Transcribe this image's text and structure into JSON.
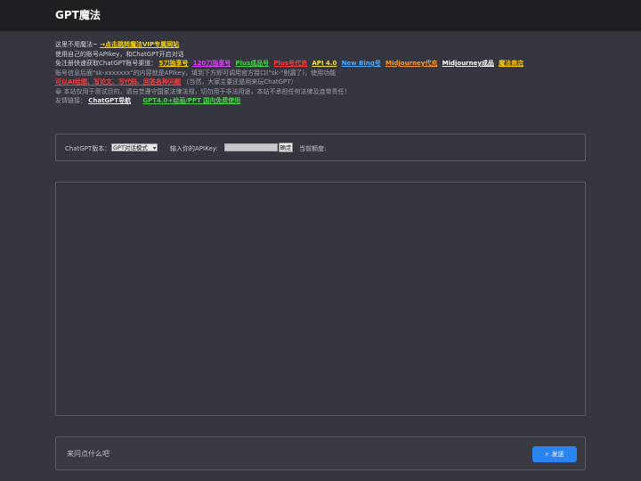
{
  "header": {
    "title": "GPT魔法"
  },
  "notice": {
    "line1": {
      "prefix": "这里不用魔法~",
      "link": "→点击跳转魔法VIP专属网站"
    },
    "line2": "使用自己的账号APIkey，和ChatGPT开启对话",
    "line3": {
      "prefix": "免注册快速获取ChatGPT账号渠道：",
      "links": [
        "5刀独享号",
        "120刀独享号",
        "Plus成品号",
        "Plus号代充",
        "API 4.0",
        "New Bing号",
        "Midjourney代充",
        "Midjourney成品",
        "魔法商店"
      ]
    },
    "line4": "账号信息后面\"sk-xxxxxxx\"的内容就是APIkey，填到下方即可调用官方接口(\"sk-\"别漏了)，使用功能",
    "line5": {
      "red": "可以AI绘图、写论文、写代码、回答各种问题",
      "rest": "（当然，大家主要还是用来玩ChatGPT）"
    },
    "line6": "😀 本站仅用于测试目的，请自觉遵守国家法律法规，切勿用于非法用途，本站不承担任何法律及连带责任！",
    "line7": {
      "prefix": "友情链接：",
      "link1": "ChatGPT导航",
      "link2": "GPT4.0+绘画/PPT 国内免费使用"
    }
  },
  "config": {
    "version_label": "ChatGPT版本：",
    "version_selected": "GPT对话模式",
    "apikey_label": "输入你的APIKey:",
    "confirm_label": "确定",
    "quota_label": "当前额度:"
  },
  "composer": {
    "placeholder": "来问点什么吧",
    "send_label": "发送",
    "send_icon": "send-icon"
  },
  "colors": {
    "background": "#363640",
    "topbar": "#202024",
    "send_button": "#2a83f0"
  }
}
